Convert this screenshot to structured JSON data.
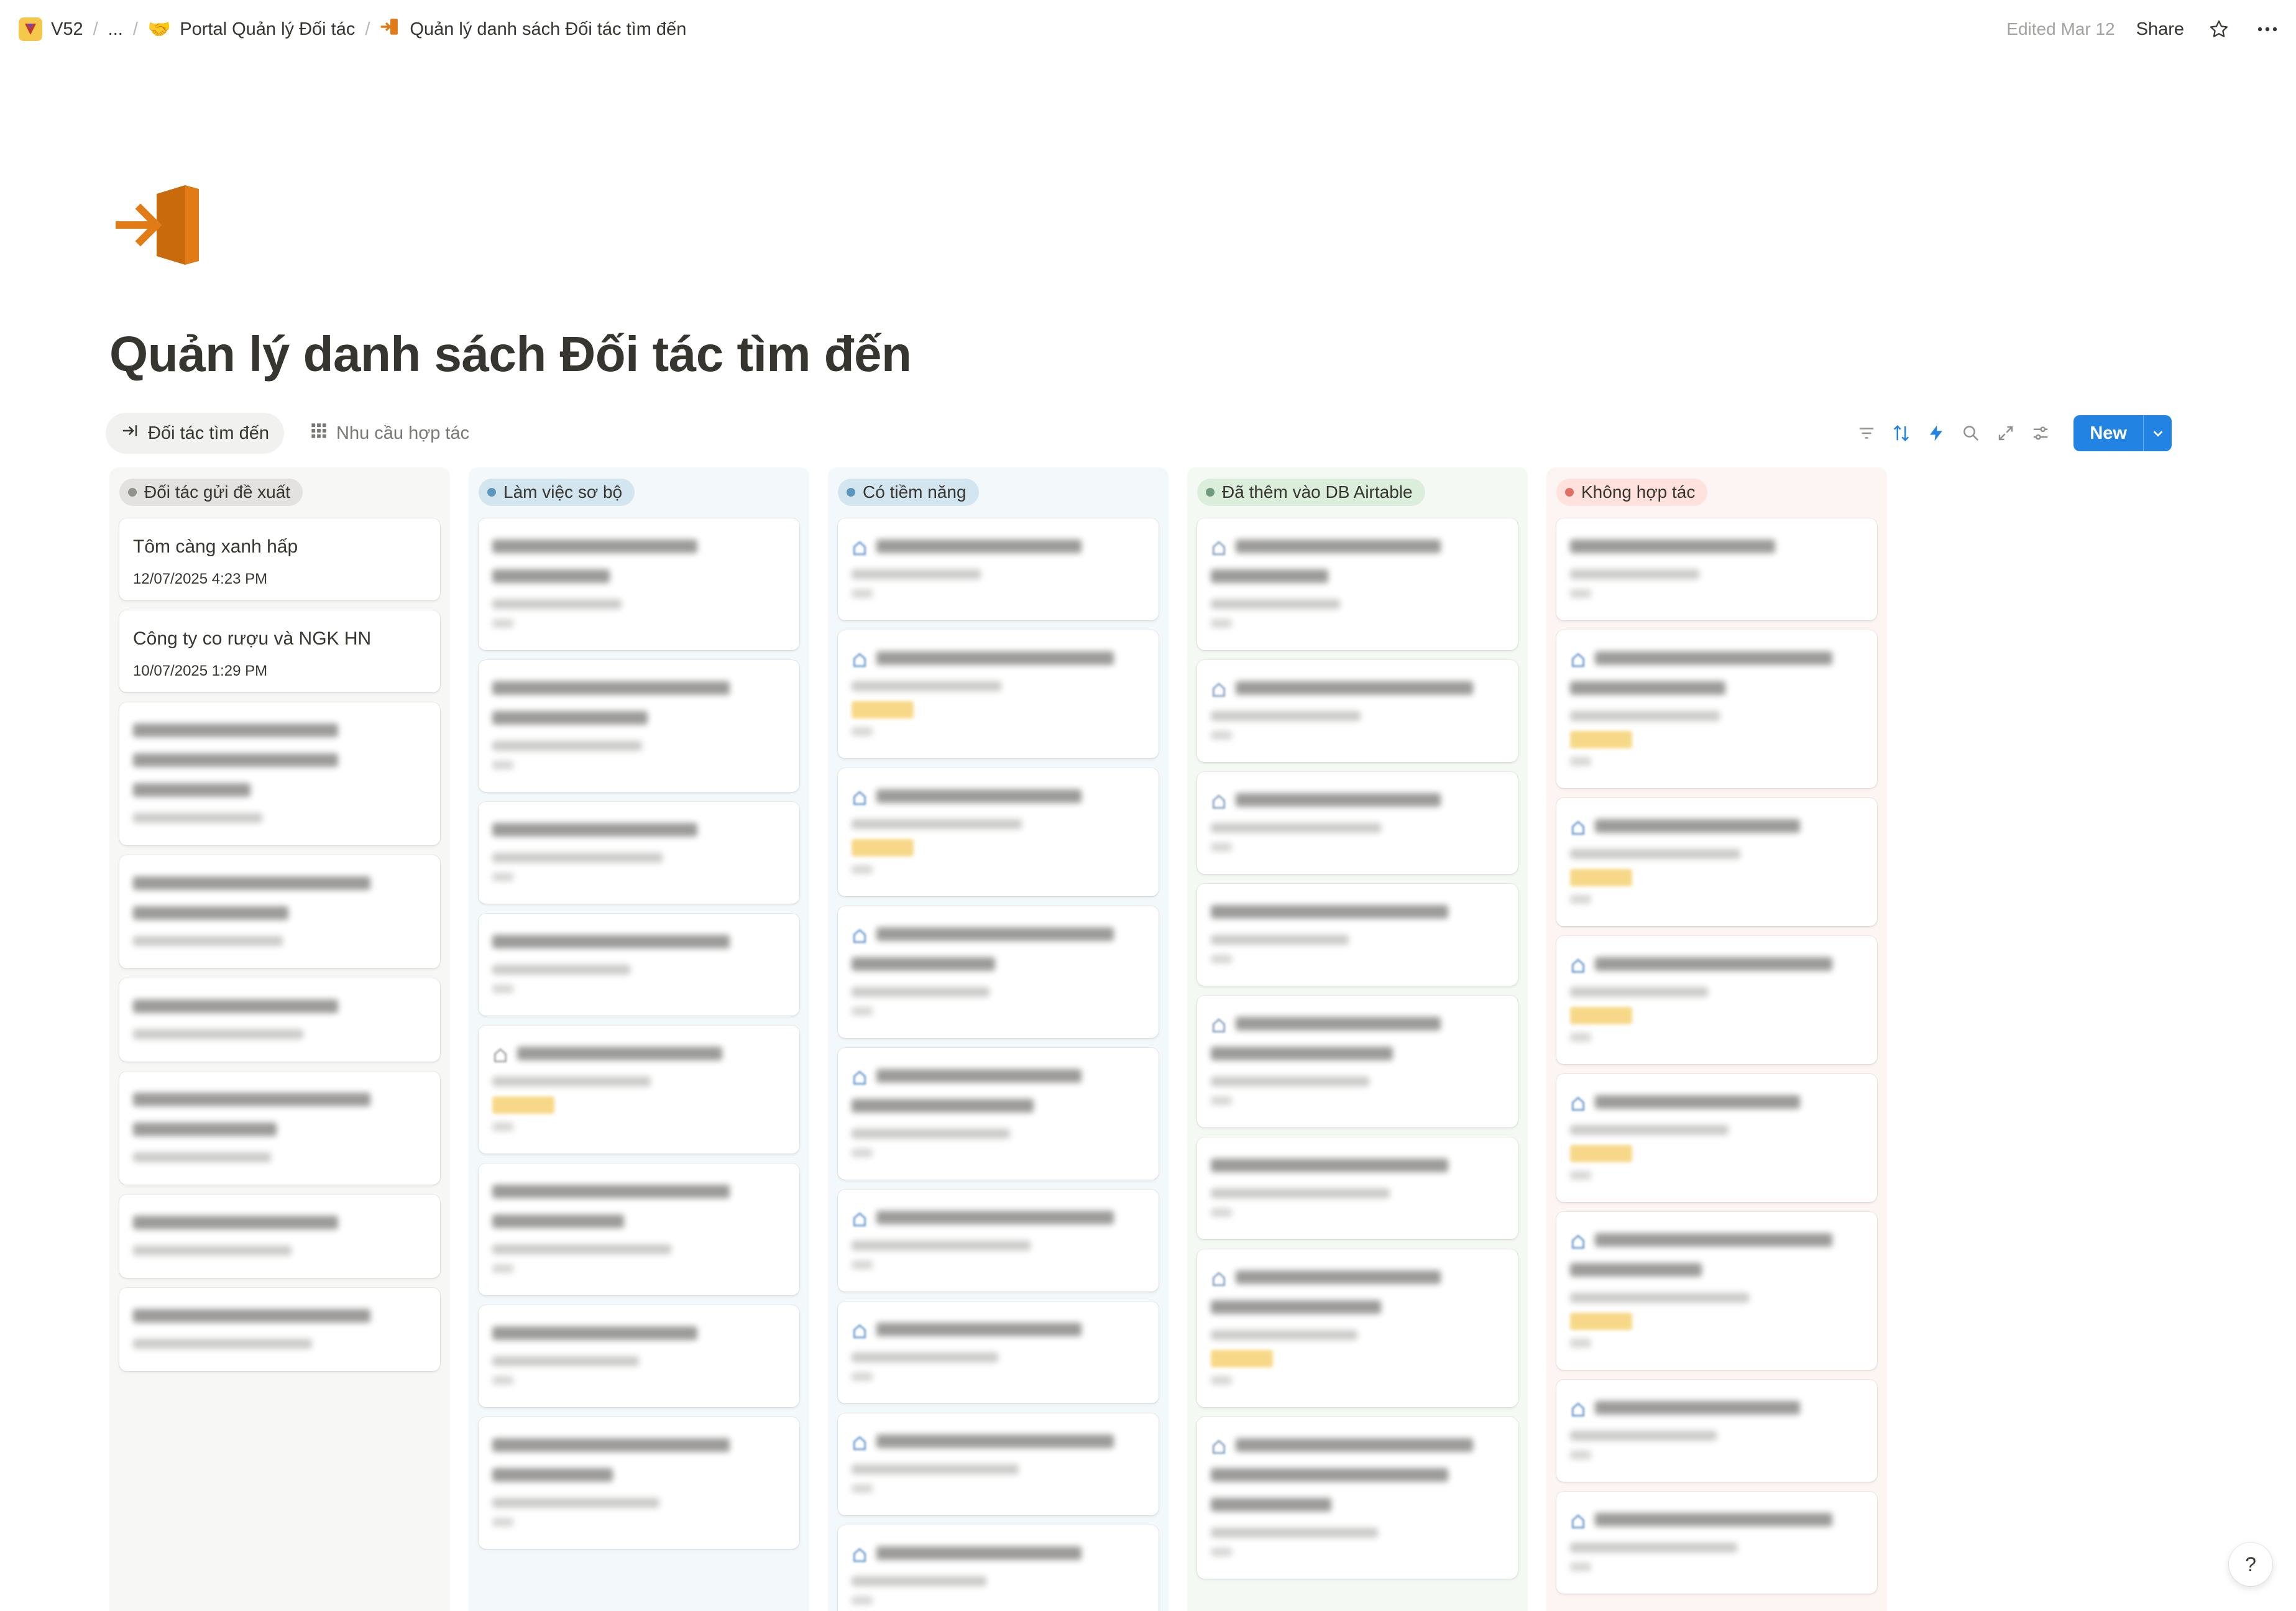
{
  "breadcrumb": {
    "workspace": "V52",
    "ellipsis": "...",
    "parent": "Portal Quản lý Đối tác",
    "current": "Quản lý danh sách Đối tác tìm đến"
  },
  "topbar": {
    "edited": "Edited Mar 12",
    "share": "Share"
  },
  "page": {
    "title": "Quản lý danh sách Đối tác tìm đến",
    "icon": "arrow-into-door-icon",
    "accent": "#e07b16"
  },
  "views": [
    {
      "label": "Đối tác tìm đến",
      "icon": "arrow-right-to-line-icon",
      "active": true
    },
    {
      "label": "Nhu cầu hợp tác",
      "icon": "grid-icon",
      "active": false
    }
  ],
  "toolbar": {
    "new_label": "New",
    "icons": [
      "filter-icon",
      "sort-icon",
      "automation-icon",
      "search-icon",
      "expand-icon",
      "settings-icon"
    ],
    "new_color": "#2383e2"
  },
  "columns": [
    {
      "status": "Đối tác gửi đề xuất",
      "color": "#91918e",
      "pill_bg": "#e3e2e0",
      "bg": "#f7f7f5",
      "cards": [
        {
          "title": "Tôm càng xanh hấp",
          "date": "12/07/2025 4:23 PM"
        },
        {
          "title": "Công ty co rượu và NGK HN",
          "date": "10/07/2025 1:29 PM"
        }
      ]
    },
    {
      "status": "Làm việc sơ bộ",
      "color": "#5b97bd",
      "pill_bg": "#d3e5ef",
      "bg": "#f3f8fb",
      "cards": []
    },
    {
      "status": "Có tiềm năng",
      "color": "#5b97bd",
      "pill_bg": "#d3e5ef",
      "bg": "#f3f8fb",
      "cards": []
    },
    {
      "status": "Đã thêm vào DB Airtable",
      "color": "#6c9b7d",
      "pill_bg": "#dbeddb",
      "bg": "#f4f9f4",
      "cards": []
    },
    {
      "status": "Không hợp tác",
      "color": "#e16f64",
      "pill_bg": "#ffe2dd",
      "bg": "#fdf5f3",
      "cards": []
    }
  ],
  "help_button": "?"
}
